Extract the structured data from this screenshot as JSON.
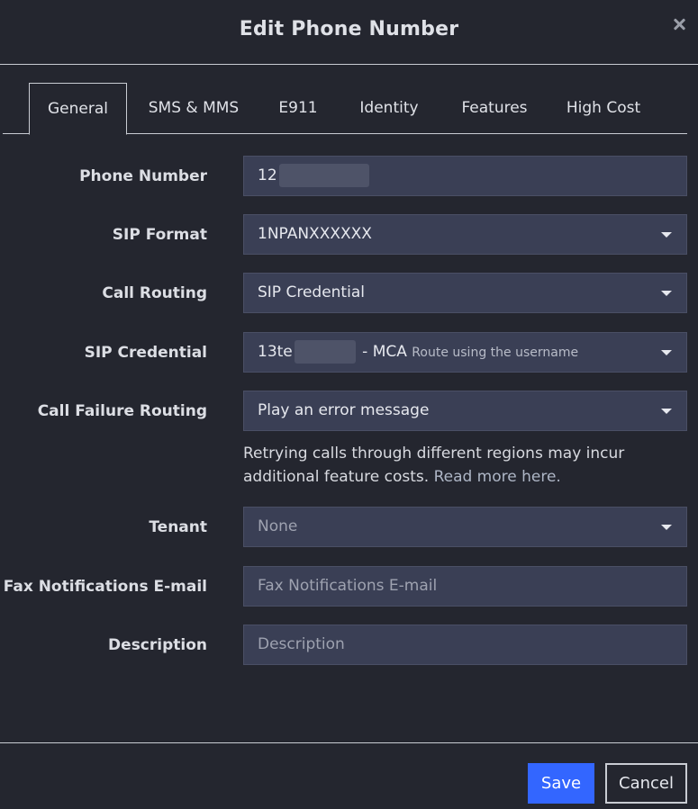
{
  "dialog": {
    "title": "Edit Phone Number"
  },
  "tabs": [
    {
      "label": "General",
      "active": true
    },
    {
      "label": "SMS & MMS"
    },
    {
      "label": "E911"
    },
    {
      "label": "Identity"
    },
    {
      "label": "Features"
    },
    {
      "label": "High Cost"
    }
  ],
  "form": {
    "phone_number": {
      "label": "Phone Number",
      "value_prefix": "12"
    },
    "sip_format": {
      "label": "SIP Format",
      "value": "1NPANXXXXXX"
    },
    "call_routing": {
      "label": "Call Routing",
      "value": "SIP Credential"
    },
    "sip_credential": {
      "label": "SIP Credential",
      "value_prefix": "13te",
      "value_suffix": "- MCA",
      "hint": "Route using the username"
    },
    "call_failure_routing": {
      "label": "Call Failure Routing",
      "value": "Play an error message",
      "help_text": "Retrying calls through different regions may incur additional feature costs.",
      "help_link": "Read more here."
    },
    "tenant": {
      "label": "Tenant",
      "value": "None"
    },
    "fax_email": {
      "label": "Fax Notifications E-mail",
      "placeholder": "Fax Notifications E-mail"
    },
    "description": {
      "label": "Description",
      "placeholder": "Description"
    }
  },
  "footer": {
    "save_label": "Save",
    "cancel_label": "Cancel"
  },
  "colors": {
    "background": "#24262f",
    "field_bg": "#3a3f55",
    "accent": "#3366ff"
  }
}
